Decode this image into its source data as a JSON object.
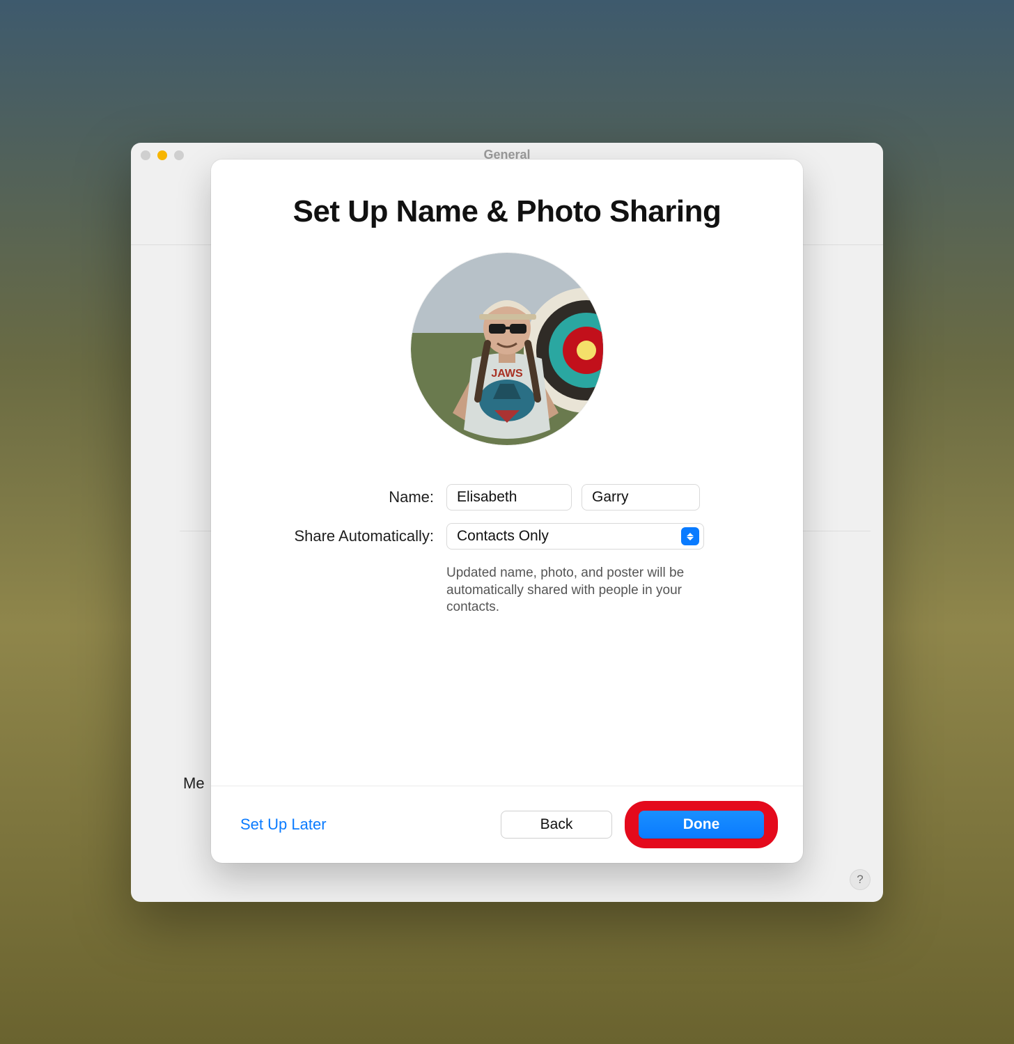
{
  "window": {
    "title": "General"
  },
  "sheet": {
    "title": "Set Up Name & Photo Sharing",
    "form": {
      "name_label": "Name:",
      "first_name": "Elisabeth",
      "last_name": "Garry",
      "share_label": "Share Automatically:",
      "share_value": "Contacts Only",
      "share_hint": "Updated name, photo, and poster will be automatically shared with people in your contacts."
    },
    "footer": {
      "setup_later": "Set Up Later",
      "back": "Back",
      "done": "Done"
    }
  },
  "background": {
    "side_label_fragment": "Me",
    "help_symbol": "?"
  }
}
